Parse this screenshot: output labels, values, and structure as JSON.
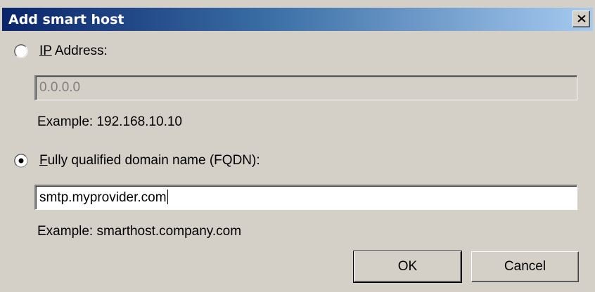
{
  "dialog": {
    "title": "Add smart host",
    "close_icon": "close-icon"
  },
  "ip_option": {
    "label_prefix": "",
    "label_accel": "I",
    "label_rest_1": "",
    "label_accel_2": "P",
    "label_rest": " Address:",
    "selected": false
  },
  "ip_field": {
    "value": "0.0.0.0",
    "enabled": false
  },
  "ip_example": "Example: 192.168.10.10",
  "fqdn_option": {
    "label_accel": "F",
    "label_rest": "ully qualified domain name (FQDN):",
    "selected": true
  },
  "fqdn_field": {
    "value": "smtp.myprovider.com",
    "enabled": true
  },
  "fqdn_example": "Example: smarthost.company.com",
  "buttons": {
    "ok": "OK",
    "cancel": "Cancel"
  }
}
